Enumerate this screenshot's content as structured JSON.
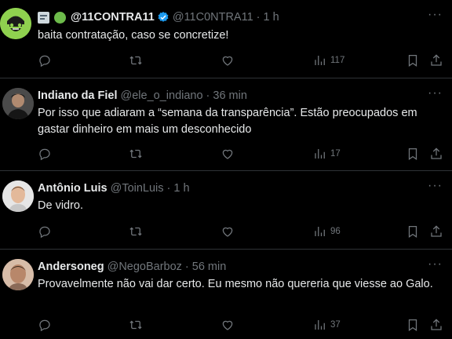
{
  "tweets": [
    {
      "name": "@11CONTRA11",
      "handle": "@11C0NTRA11",
      "time": "1 h",
      "text": "baita contratação, caso se concretize!",
      "views": "117",
      "avatar_color": "#8fd14f",
      "verified_color": "#1d9bf0"
    },
    {
      "name": "Indiano da Fiel",
      "handle": "@ele_o_indiano",
      "time": "36 min",
      "text": "Por isso que adiaram a “semana da transparência”. Estão preocupados em gastar dinheiro em mais um desconhecido",
      "views": "17"
    },
    {
      "name": "Antônio Luis",
      "handle": "@ToinLuis",
      "time": "1 h",
      "text": "De vidro.",
      "views": "96"
    },
    {
      "name": "Andersoneg",
      "handle": "@NegoBarboz",
      "time": "56 min",
      "text": "Provavelmente não vai dar certo. Eu mesmo não quereria que viesse ao Galo.",
      "views": "37"
    }
  ],
  "colors": {
    "background": "#000000",
    "text": "#e7e9ea",
    "muted": "#71767b",
    "divider": "#2f3336"
  },
  "icons": [
    "reply-icon",
    "retweet-icon",
    "like-icon",
    "views-icon",
    "bookmark-icon",
    "share-icon",
    "more-icon",
    "verified-icon"
  ]
}
